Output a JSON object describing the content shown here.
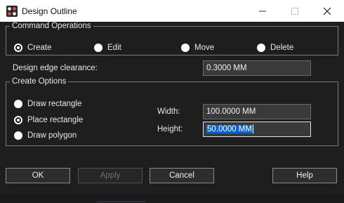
{
  "window": {
    "title": "Design Outline",
    "controls": [
      "minimize-icon",
      "maximize-icon",
      "close-icon"
    ]
  },
  "command_operations": {
    "legend": "Command Operations",
    "options": [
      {
        "label": "Create",
        "checked": true
      },
      {
        "label": "Edit",
        "checked": false
      },
      {
        "label": "Move",
        "checked": false
      },
      {
        "label": "Delete",
        "checked": false
      }
    ]
  },
  "clearance": {
    "label": "Design edge clearance:",
    "value": "0.3000 MM"
  },
  "create_options": {
    "legend": "Create Options",
    "options": [
      {
        "label": "Draw rectangle",
        "checked": false
      },
      {
        "label": "Place rectangle",
        "checked": true
      },
      {
        "label": "Draw polygon",
        "checked": false
      }
    ],
    "width_label": "Width:",
    "width_value": "100.0000 MM",
    "height_label": "Height:",
    "height_value": "50.0000 MM"
  },
  "buttons": {
    "ok": "OK",
    "apply": "Apply",
    "cancel": "Cancel",
    "help": "Help"
  },
  "colors": {
    "background": "#1e1e1e",
    "selection": "#0a64d2",
    "titlebar": "#ffffff"
  }
}
